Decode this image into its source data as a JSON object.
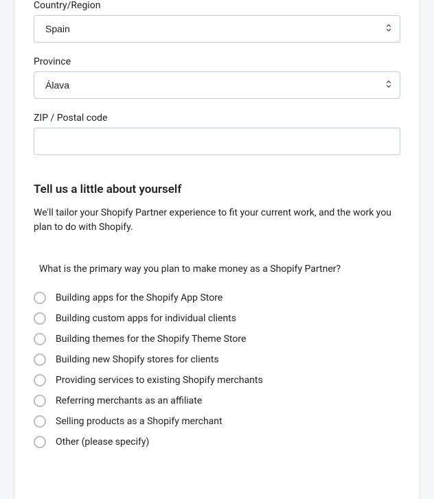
{
  "fields": {
    "country": {
      "label": "Country/Region",
      "value": "Spain"
    },
    "province": {
      "label": "Province",
      "value": "Álava"
    },
    "zip": {
      "label": "ZIP / Postal code",
      "value": ""
    }
  },
  "section": {
    "heading": "Tell us a little about yourself",
    "description": "We'll tailor your Shopify Partner experience to fit your current work, and the work you plan to do with Shopify."
  },
  "question": {
    "text": "What is the primary way you plan to make money as a Shopify Partner?",
    "options": [
      "Building apps for the Shopify App Store",
      "Building custom apps for individual clients",
      "Building themes for the Shopify Theme Store",
      "Building new Shopify stores for clients",
      "Providing services to existing Shopify merchants",
      "Referring merchants as an affiliate",
      "Selling products as a Shopify merchant",
      "Other (please specify)"
    ]
  }
}
